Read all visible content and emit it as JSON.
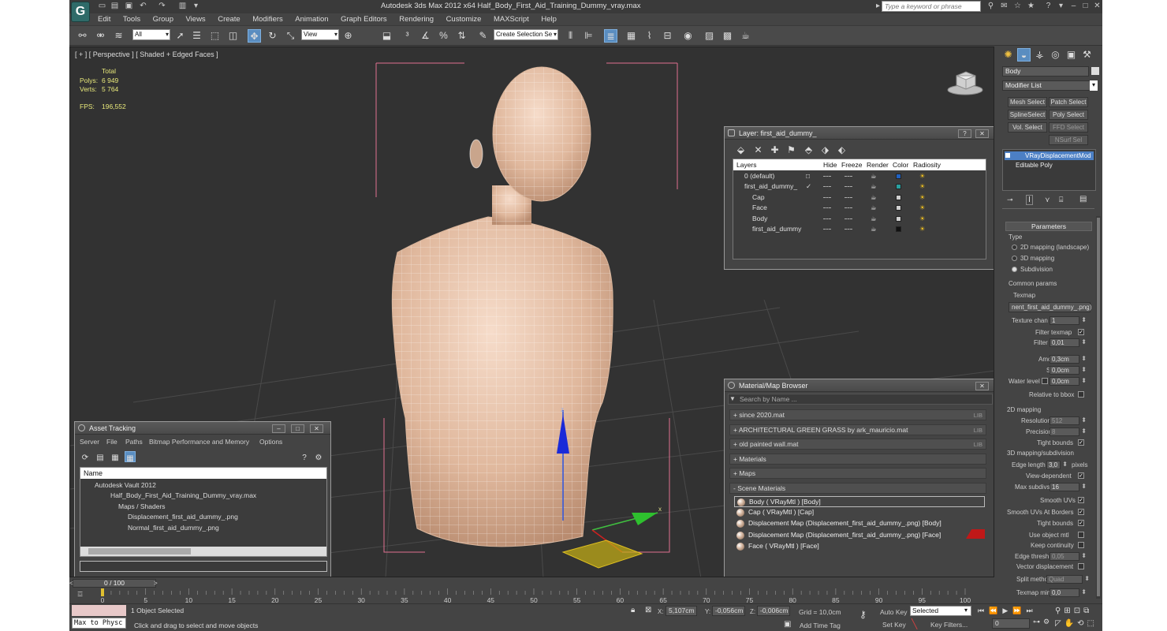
{
  "window": {
    "title": "Autodesk 3ds Max  2012 x64      Half_Body_First_Aid_Training_Dummy_vray.max",
    "search_placeholder": "Type a keyword or phrase"
  },
  "menu": [
    "Edit",
    "Tools",
    "Group",
    "Views",
    "Create",
    "Modifiers",
    "Animation",
    "Graph Editors",
    "Rendering",
    "Customize",
    "MAXScript",
    "Help"
  ],
  "toolbar": {
    "selection_filter": "All",
    "reference_coord": "View",
    "named_selection": "Create Selection Se"
  },
  "viewport": {
    "label": "[ + ] [ Perspective ] [ Shaded + Edged Faces ]",
    "stats": {
      "total_label": "Total",
      "polys_label": "Polys:",
      "polys_value": "6 949",
      "verts_label": "Verts:",
      "verts_value": "5 764",
      "fps_label": "FPS:",
      "fps_value": "196,552"
    },
    "gizmo_z": "z",
    "gizmo_x": "x"
  },
  "layer_window": {
    "title": "Layer: first_aid_dummy_",
    "columns": [
      "Layers",
      "Hide",
      "Freeze",
      "Render",
      "Color",
      "Radiosity"
    ],
    "rows": [
      {
        "name": "0 (default)",
        "color": "#2060c0"
      },
      {
        "name": "first_aid_dummy_",
        "color": "#2aa0a0"
      },
      {
        "name": "Cap",
        "color": "#d0d0d0"
      },
      {
        "name": "Face",
        "color": "#d0d0d0"
      },
      {
        "name": "Body",
        "color": "#d0d0d0"
      },
      {
        "name": "first_aid_dummy",
        "color": "#111111"
      }
    ]
  },
  "asset_tracking": {
    "title": "Asset Tracking",
    "menu": [
      "Server",
      "File",
      "Paths",
      "Bitmap Performance and Memory",
      "Options"
    ],
    "column": "Name",
    "rows": [
      "Autodesk Vault 2012",
      "Half_Body_First_Aid_Training_Dummy_vray.max",
      "Maps / Shaders",
      "Displacement_first_aid_dummy_.png",
      "Normal_first_aid_dummy_.png"
    ]
  },
  "material_browser": {
    "title": "Material/Map Browser",
    "search_placeholder": "Search by Name ...",
    "libraries": [
      {
        "label": "+ since 2020.mat",
        "tag": "LIB"
      },
      {
        "label": "+ ARCHITECTURAL GREEN GRASS by ark_mauricio.mat",
        "tag": "LIB"
      },
      {
        "label": "+ old painted wall.mat",
        "tag": "LIB"
      },
      {
        "label": "+ Materials",
        "tag": ""
      },
      {
        "label": "+ Maps",
        "tag": ""
      },
      {
        "label": "- Scene Materials",
        "tag": ""
      }
    ],
    "scene_materials": [
      "Body  ( VRayMtl )  [Body]",
      "Cap  ( VRayMtl )  [Cap]",
      "Displacement Map (Displacement_first_aid_dummy_.png) [Body]",
      "Displacement Map (Displacement_first_aid_dummy_.png) [Face]",
      "Face  ( VRayMtl )  [Face]"
    ]
  },
  "command_panel": {
    "object_name": "Body",
    "modifier_list": "Modifier List",
    "mod_buttons": [
      "Mesh Select",
      "Patch Select",
      "SplineSelect",
      "Poly Select",
      "Vol. Select",
      "FFD Select",
      "NSurf Sel"
    ],
    "stack": [
      "VRayDisplacementMod",
      "Editable Poly"
    ],
    "rollout_title": "Parameters",
    "type_label": "Type",
    "type_options": [
      "2D mapping (landscape)",
      "3D mapping",
      "Subdivision"
    ],
    "common_params": "Common params",
    "texmap_label": "Texmap",
    "texmap_value": "nent_first_aid_dummy_.png)",
    "texture_chan_label": "Texture chan",
    "texture_chan_value": "1",
    "filter_texmap": "Filter texmap",
    "filter_blur_label": "Filter blur",
    "filter_blur_value": "0,01",
    "amount_label": "Amount",
    "amount_value": "0,3cm",
    "shift_label": "Shift",
    "shift_value": "0,0cm",
    "water_label": "Water level",
    "water_value": "0,0cm",
    "relative_bbox": "Relative to bbox",
    "mapping2d": "2D mapping",
    "resolution_label": "Resolution",
    "resolution_value": "512",
    "precision_label": "Precision",
    "precision_value": "8",
    "tight_bounds": "Tight bounds",
    "mapping3d": "3D mapping/subdivision",
    "edge_length_label": "Edge length",
    "edge_length_value": "3,0",
    "pixels": "pixels",
    "view_dependent": "View-dependent",
    "max_subdivs_label": "Max subdivs",
    "max_subdivs_value": "16",
    "smooth_uvs": "Smooth UVs",
    "smooth_uvs_borders": "Smooth UVs At Borders",
    "tight_bounds2": "Tight bounds",
    "use_object_mtl": "Use object mtl",
    "keep_continuity": "Keep continuity",
    "edge_thresh_label": "Edge thresh",
    "edge_thresh_value": "0,05",
    "vector_disp": "Vector displacement",
    "split_method_label": "Split method",
    "split_method_value": "Quad",
    "texmap_min_label": "Texmap min:",
    "texmap_min_value": "0,0"
  },
  "timeline": {
    "frame_label": "0 / 100",
    "ticks": [
      "0",
      "5",
      "10",
      "15",
      "20",
      "25",
      "30",
      "35",
      "40",
      "45",
      "50",
      "55",
      "60",
      "65",
      "70",
      "75",
      "80",
      "85",
      "90",
      "95",
      "100"
    ]
  },
  "status": {
    "listener": "Max to Physc",
    "selected": "1 Object Selected",
    "prompt": "Click and drag to select and move objects",
    "x_label": "X:",
    "x_value": "5,107cm",
    "y_label": "Y:",
    "y_value": "-0,056cm",
    "z_label": "Z:",
    "z_value": "-0,006cm",
    "grid": "Grid = 10,0cm",
    "add_time_tag": "Add Time Tag",
    "auto_key": "Auto Key",
    "selected_dropdown": "Selected",
    "set_key": "Set Key",
    "key_filters": "Key Filters...",
    "frame_value": "0"
  }
}
